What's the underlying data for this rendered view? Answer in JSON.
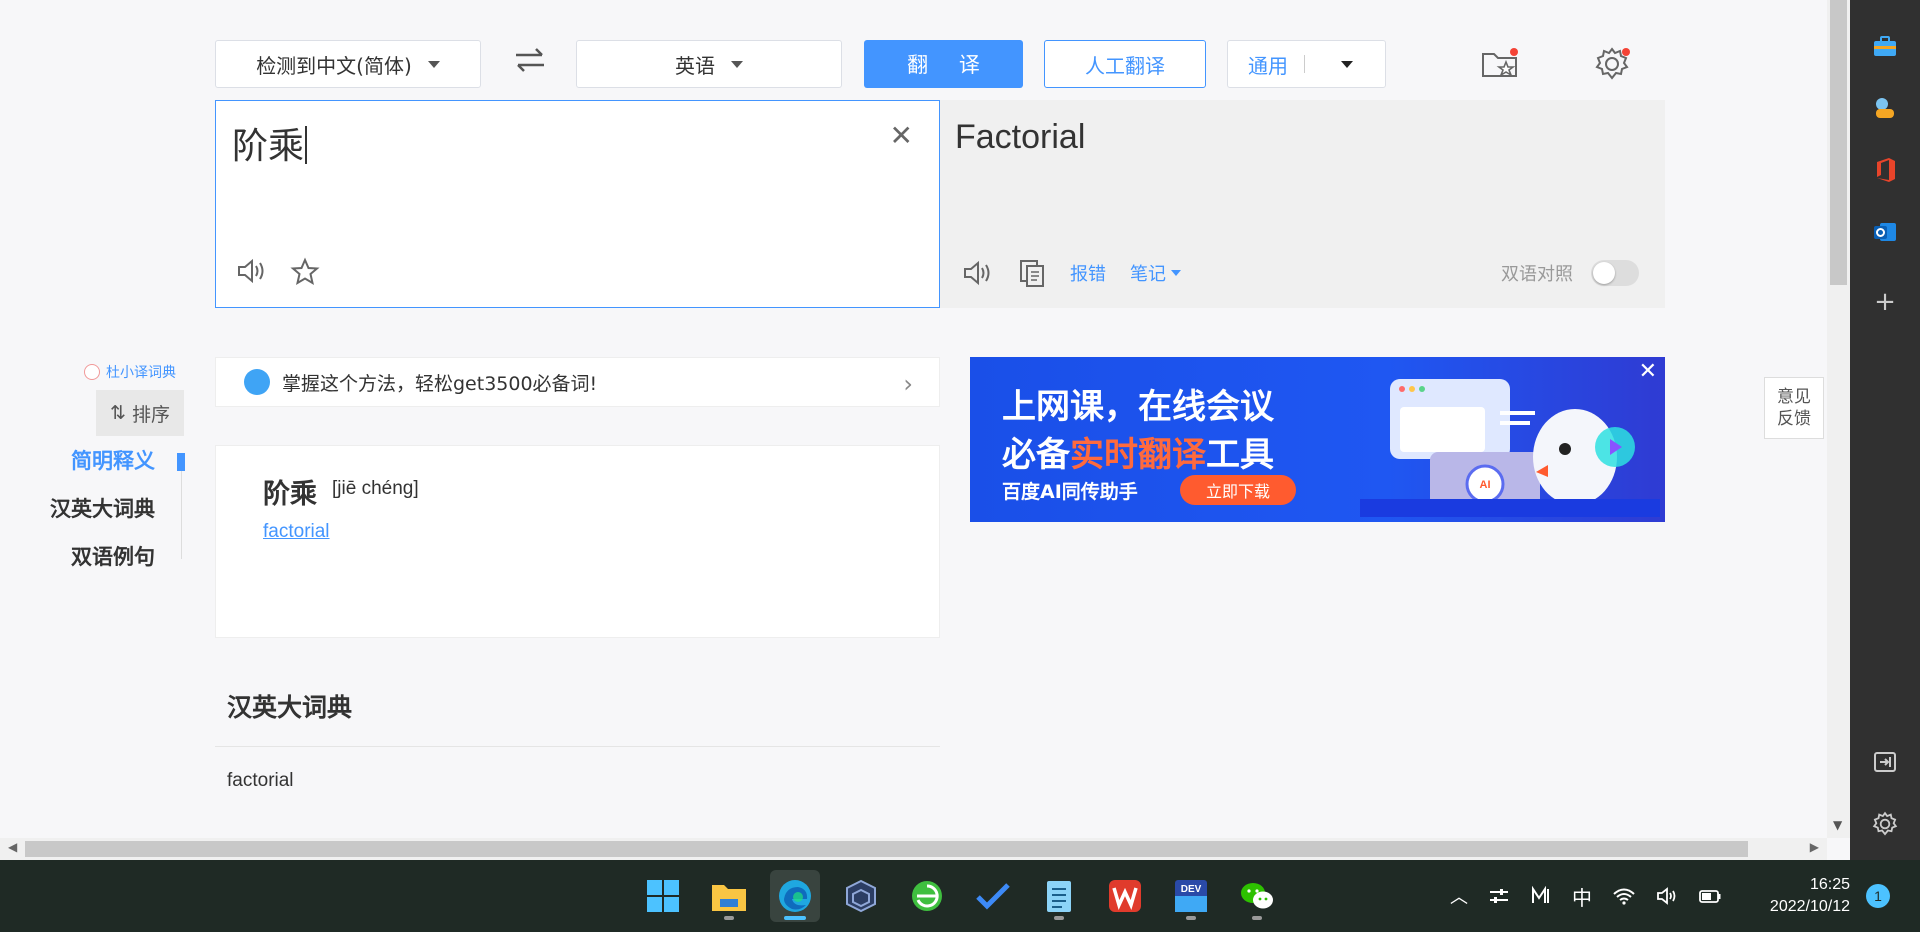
{
  "toolbar": {
    "source_lang": "检测到中文(简体)",
    "target_lang": "英语",
    "translate_label": "翻 译",
    "human_translate_label": "人工翻译",
    "domain_label": "通用"
  },
  "input": {
    "text": "阶乘"
  },
  "output": {
    "text": "Factorial",
    "report_label": "报错",
    "notes_label": "笔记",
    "bilingual_label": "双语对照"
  },
  "left_nav": {
    "brand": "杜小译词典",
    "sort_label": "排序",
    "items": [
      {
        "label": "简明释义",
        "active": true
      },
      {
        "label": "汉英大词典",
        "active": false
      },
      {
        "label": "双语例句",
        "active": false
      }
    ]
  },
  "promo": {
    "text": "掌握这个方法，轻松get3500必备词!"
  },
  "ad": {
    "line1": "上网课，在线会议",
    "line2_a": "必备",
    "line2_hl": "实时翻译",
    "line2_b": "工具",
    "brand": "百度AI同传助手",
    "download": "立即下载",
    "ai_badge": "AI"
  },
  "result": {
    "word": "阶乘",
    "pinyin": "[jiē chéng]",
    "translation": "factorial"
  },
  "section": {
    "title": "汉英大词典",
    "first_item": "factorial"
  },
  "feedback": {
    "line1": "意见",
    "line2": "反馈"
  },
  "taskbar": {
    "apps": [
      "windows-start",
      "file-explorer",
      "edge",
      "virtualbox",
      "360-browser",
      "todo",
      "notepad",
      "wps-office",
      "dev-cpp",
      "wechat"
    ],
    "tray_ime": "中",
    "time": "16:25",
    "date": "2022/10/12",
    "notifications": "1"
  },
  "colors": {
    "accent": "#4395ff",
    "ad_bg": "#1f57f2",
    "ad_highlight": "#ff6a3d",
    "taskbar": "#1f2a25",
    "edge_sidebar": "#303030"
  }
}
